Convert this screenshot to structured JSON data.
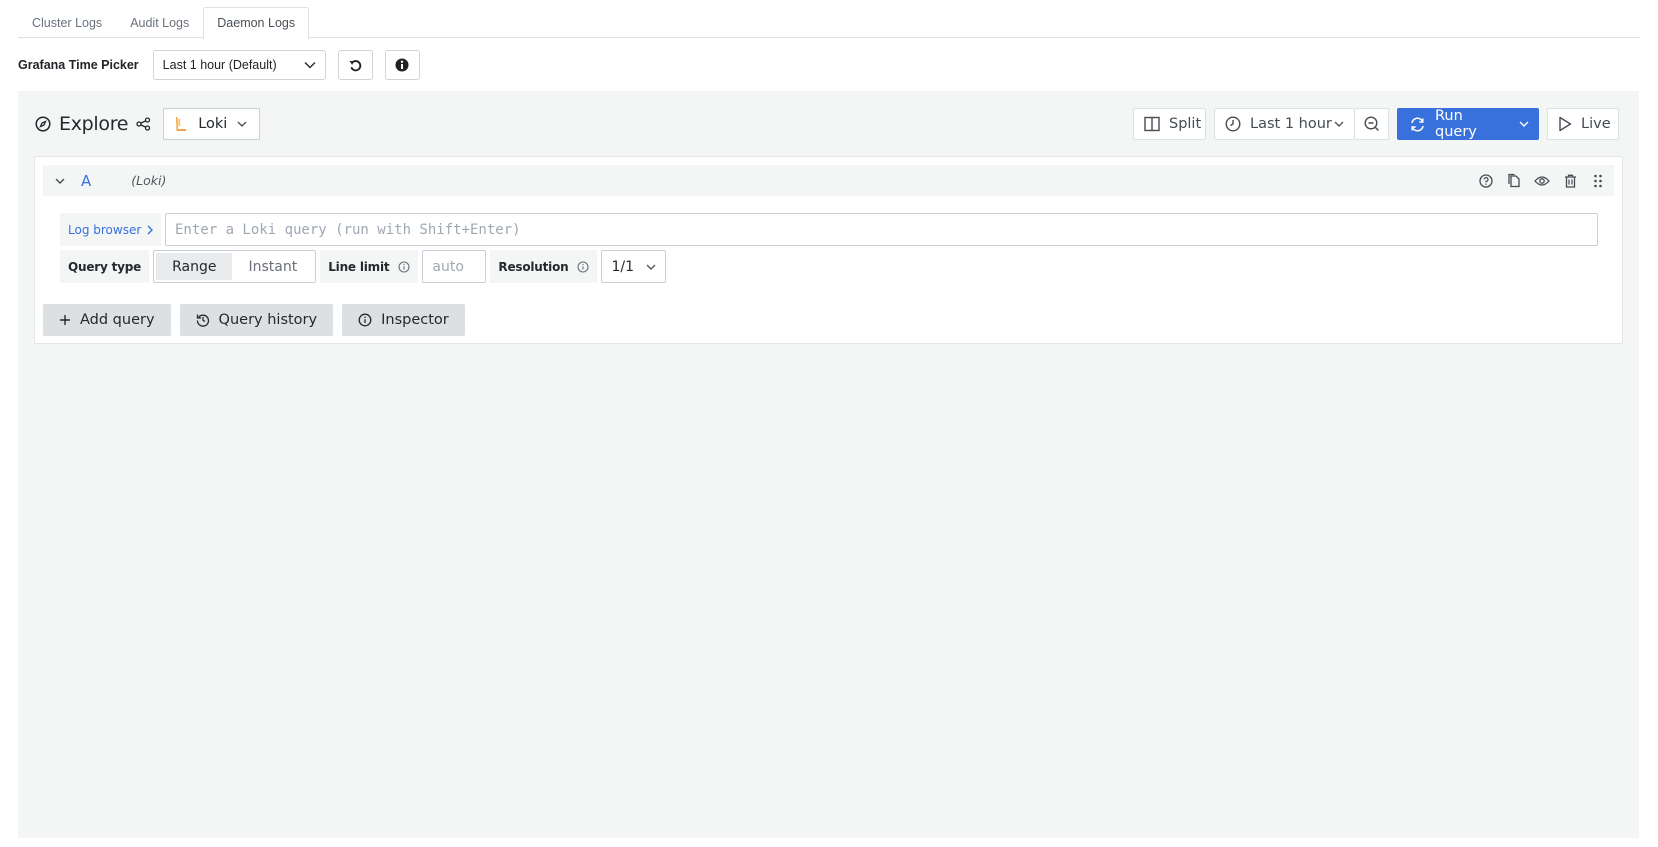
{
  "tabs": [
    {
      "label": "Cluster Logs",
      "active": false
    },
    {
      "label": "Audit Logs",
      "active": false
    },
    {
      "label": "Daemon Logs",
      "active": true
    }
  ],
  "time_picker": {
    "label": "Grafana Time Picker",
    "selected": "Last 1 hour (Default)",
    "refresh_icon": "refresh-icon",
    "info_icon": "info-circle-icon"
  },
  "explore": {
    "title": "Explore",
    "datasource": "Loki",
    "toolbar": {
      "split_label": "Split",
      "time_range": "Last 1 hour",
      "run_query_label": "Run query",
      "live_label": "Live"
    },
    "query": {
      "ref_id": "A",
      "datasource_label": "(Loki)",
      "log_browser_label": "Log browser",
      "query_placeholder": "Enter a Loki query (run with Shift+Enter)",
      "query_type_label": "Query type",
      "query_type_options": [
        "Range",
        "Instant"
      ],
      "query_type_selected": "Range",
      "line_limit_label": "Line limit",
      "line_limit_placeholder": "auto",
      "resolution_label": "Resolution",
      "resolution_value": "1/1"
    },
    "actions": {
      "add_query": "Add query",
      "query_history": "Query history",
      "inspector": "Inspector"
    },
    "colors": {
      "primary": "#3871dc",
      "panel_bg": "#f4f5f5"
    }
  }
}
